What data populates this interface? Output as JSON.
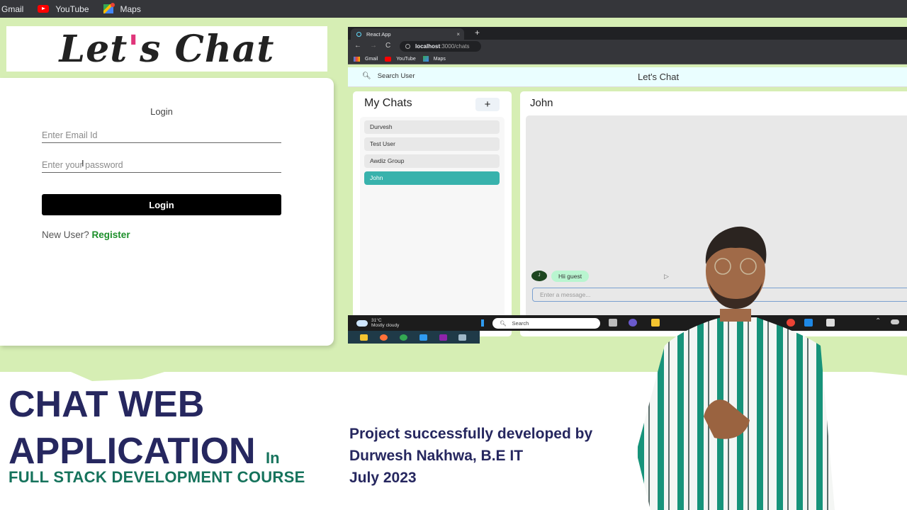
{
  "top_bookmarks": [
    {
      "label": "Gmail",
      "icon": "gmail-icon"
    },
    {
      "label": "YouTube",
      "icon": "youtube-icon"
    },
    {
      "label": "Maps",
      "icon": "maps-icon"
    }
  ],
  "logo": {
    "text_main_1": "Let",
    "text_apos": "'",
    "text_main_2": "s Chat"
  },
  "login": {
    "title": "Login",
    "email_placeholder": "Enter Email Id",
    "password_placeholder": "Enter your password",
    "button_label": "Login",
    "new_user_text": "New User?",
    "register_label": "Register"
  },
  "browser": {
    "tab_title": "React App",
    "tab_close": "×",
    "new_tab": "+",
    "nav": {
      "back": "←",
      "forward": "→",
      "reload": "C"
    },
    "url_host": "localhost",
    "url_path": ":3000/chats",
    "bookmarks": [
      "Gmail",
      "YouTube",
      "Maps"
    ]
  },
  "app": {
    "search_label": "Search User",
    "title": "Let's Chat",
    "my_chats_title": "My Chats",
    "add_label": "+",
    "chats": [
      {
        "name": "Durvesh",
        "active": false
      },
      {
        "name": "Test User",
        "active": false
      },
      {
        "name": "Awdiz Group",
        "active": false
      },
      {
        "name": "John",
        "active": true
      }
    ],
    "active_chat_title": "John",
    "messages": [
      {
        "sender_initial": "J",
        "text": "Hii guest"
      }
    ],
    "message_placeholder": "Enter a message..."
  },
  "taskbar": {
    "temperature": "31°C",
    "weather": "Mostly cloudy",
    "search_label": "Search"
  },
  "promo": {
    "headline_line1": "CHAT WEB",
    "headline_line2": "APPLICATION",
    "headline_in": "In",
    "subheadline": "FULL STACK DEVELOPMENT COURSE",
    "credit_line1": "Project successfully developed by",
    "credit_line2": "Durwesh Nakhwa, B.E IT",
    "credit_line3": "July 2023"
  },
  "colors": {
    "background_green": "#d6eeb4",
    "headline_navy": "#26275f",
    "subhead_teal": "#16735c",
    "active_chat_teal": "#38b2ac",
    "register_green": "#1c8f2a",
    "message_bubble": "#b9f5d0"
  }
}
